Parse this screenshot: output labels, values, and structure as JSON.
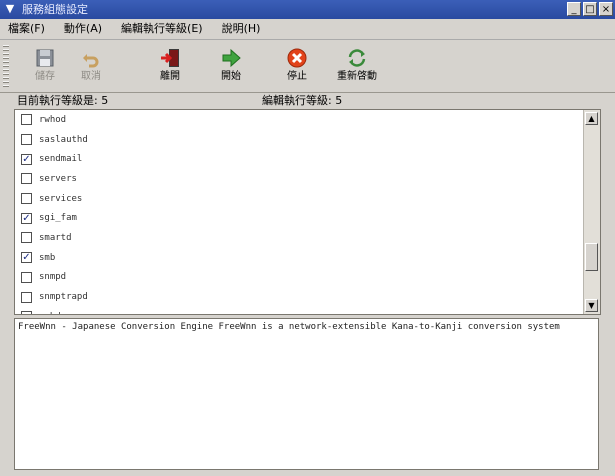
{
  "window": {
    "title": "服務組態設定",
    "controls": [
      "_",
      "□",
      "×"
    ]
  },
  "menubar": {
    "items": [
      "檔案(F)",
      "動作(A)",
      "編輯執行等級(E)",
      "說明(H)"
    ]
  },
  "toolbar": {
    "buttons": [
      {
        "label": "儲存",
        "icon": "save-icon",
        "enabled": false
      },
      {
        "label": "取消",
        "icon": "undo-icon",
        "enabled": false
      },
      {
        "label": "離開",
        "icon": "exit-icon",
        "enabled": true
      },
      {
        "label": "開始",
        "icon": "start-icon",
        "enabled": true
      },
      {
        "label": "停止",
        "icon": "stop-icon",
        "enabled": true
      },
      {
        "label": "重新啓動",
        "icon": "restart-icon",
        "enabled": true
      }
    ]
  },
  "status": {
    "current_runlevel": "目前執行等級是: 5",
    "editing_runlevel": "編輯執行等級: 5"
  },
  "services": {
    "items": [
      {
        "name": "rwhod",
        "checked": false
      },
      {
        "name": "saslauthd",
        "checked": false
      },
      {
        "name": "sendmail",
        "checked": true
      },
      {
        "name": "servers",
        "checked": false
      },
      {
        "name": "services",
        "checked": false
      },
      {
        "name": "sgi_fam",
        "checked": true
      },
      {
        "name": "smartd",
        "checked": false
      },
      {
        "name": "smb",
        "checked": true
      },
      {
        "name": "snmpd",
        "checked": false
      },
      {
        "name": "snmptrapd",
        "checked": false
      },
      {
        "name": "sshd",
        "checked": false
      }
    ]
  },
  "description": {
    "text": "FreeWnn - Japanese Conversion Engine FreeWnn is a network-extensible Kana-to-Kanji conversion system"
  },
  "colors": {
    "titlebar": "#2a4aa0",
    "window_bg": "#d6d3ce",
    "check_mark": "#1a2a80"
  }
}
